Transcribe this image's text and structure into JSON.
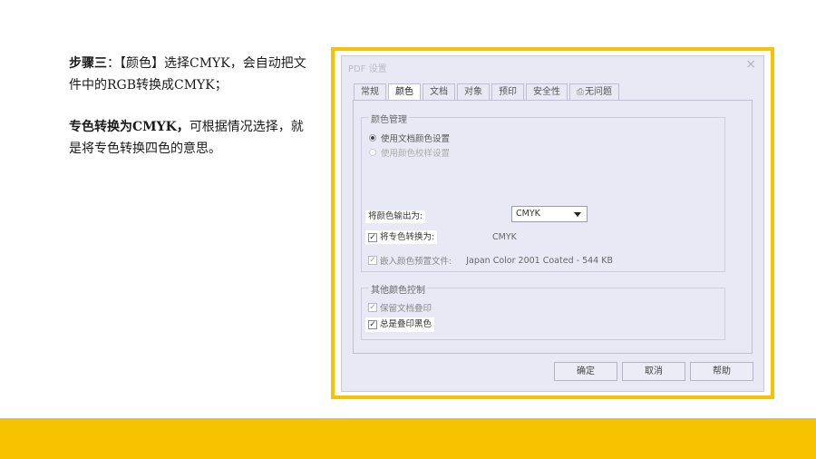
{
  "instructions": {
    "p1_bold": "步骤三",
    "p1_text": "：【颜色】选择CMYK，会自动把文件中的RGB转换成CMYK；",
    "p2_bold": "专色转换为CMYK，",
    "p2_text": "可根据情况选择，就是将专色转换四色的意思。"
  },
  "dialog": {
    "title": "PDF 设置",
    "close": "×",
    "tabs": [
      "常规",
      "颜色",
      "文档",
      "对象",
      "预印",
      "安全性",
      "无问题"
    ],
    "active_tab": "颜色",
    "color_mgmt": {
      "legend": "颜色管理",
      "radio1": "使用文档颜色设置",
      "radio2": "使用颜色校样设置",
      "output_label": "将颜色输出为:",
      "output_value": "CMYK",
      "spot_label": "将专色转换为:",
      "spot_value": "CMYK",
      "embed_label": "嵌入颜色预置文件:",
      "embed_value": "Japan Color 2001 Coated - 544 KB"
    },
    "other": {
      "legend": "其他颜色控制",
      "keep_overprint": "保留文档叠印",
      "always_overprint": "总是叠印黑色"
    },
    "buttons": {
      "ok": "确定",
      "cancel": "取消",
      "help": "帮助"
    }
  },
  "colors": {
    "accent": "#f7c200"
  }
}
